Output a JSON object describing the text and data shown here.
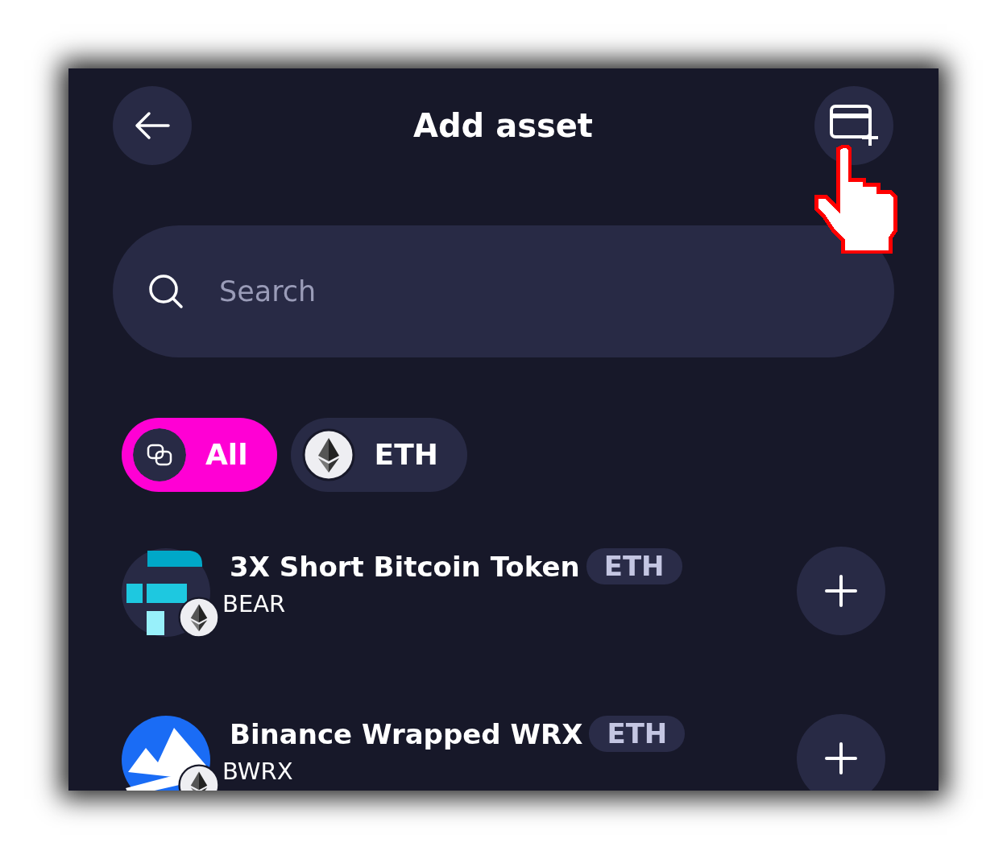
{
  "header": {
    "title": "Add asset"
  },
  "search": {
    "placeholder": "Search"
  },
  "filters": [
    {
      "label": "All",
      "kind": "all",
      "selected": true
    },
    {
      "label": "ETH",
      "kind": "eth",
      "selected": false
    }
  ],
  "assets": [
    {
      "name": "3X Short Bitcoin Token",
      "network": "ETH",
      "symbol": "BEAR",
      "kind": "blocks"
    },
    {
      "name": "Binance Wrapped WRX",
      "network": "ETH",
      "symbol": "BWRX",
      "kind": "mountain"
    }
  ]
}
